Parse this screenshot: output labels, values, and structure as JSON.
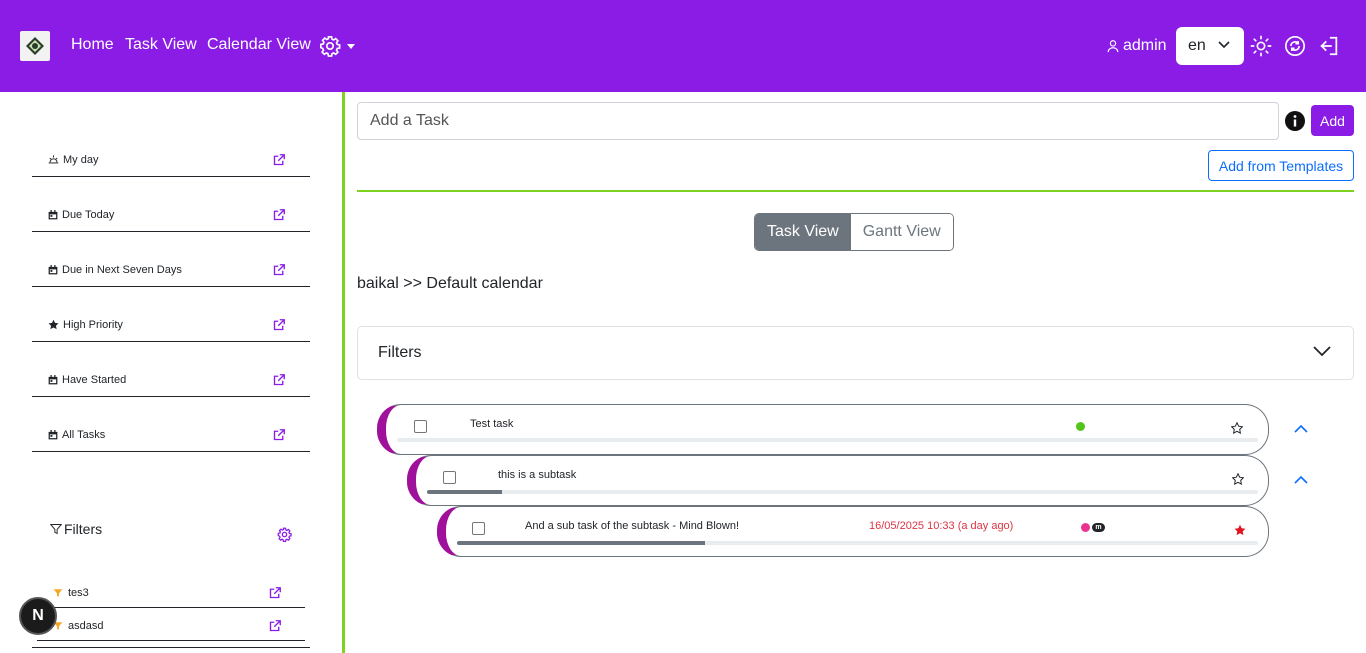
{
  "navbar": {
    "links": {
      "home": "Home",
      "task_view": "Task View",
      "calendar_view": "Calendar View"
    },
    "user": "admin",
    "language": "en",
    "brand_color": "#8a1ce6"
  },
  "sidebar": {
    "items": [
      {
        "label": "My day",
        "icon": "sun-horizon-icon"
      },
      {
        "label": "Due Today",
        "icon": "calendar-icon"
      },
      {
        "label": "Due in Next Seven Days",
        "icon": "calendar-icon"
      },
      {
        "label": "High Priority",
        "icon": "star-icon"
      },
      {
        "label": "Have Started",
        "icon": "calendar-icon"
      },
      {
        "label": "All Tasks",
        "icon": "calendar-icon"
      }
    ],
    "filters_title": "Filters",
    "filters": [
      {
        "label": "tes3"
      },
      {
        "label": "asdasd"
      }
    ],
    "badge": "N"
  },
  "main": {
    "task_input_placeholder": "Add a Task",
    "add_label": "Add",
    "templates_label": "Add from Templates",
    "views": {
      "task": "Task View",
      "gantt": "Gantt View"
    },
    "breadcrumb": "baikal >> Default calendar",
    "filters_label": "Filters"
  },
  "tasks": [
    {
      "title": "Test task",
      "progress": 0,
      "due": "",
      "status_color": "#52c41a"
    },
    {
      "title": "this is a subtask",
      "progress": 9,
      "due": ""
    },
    {
      "title": "And a sub task of the subtask - Mind Blown!",
      "progress": 31,
      "due": "16/05/2025 10:33 (a day ago)",
      "status_color": "#e8338f",
      "label_badge": "m"
    }
  ],
  "colors": {
    "accent": "#8a1ce6",
    "divider": "#7ed321",
    "task_border": "#a0119b",
    "due": "#dc3545"
  }
}
